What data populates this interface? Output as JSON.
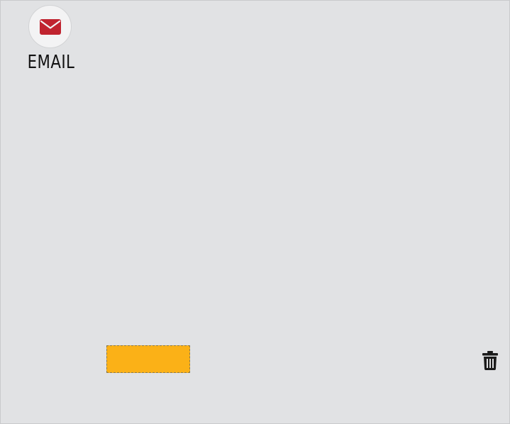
{
  "email_widget": {
    "label": "EMAIL",
    "icon": "envelope-icon",
    "icon_color": "#c0232f"
  },
  "placeholder_block": {
    "color": "#fbb117"
  },
  "trash": {
    "icon": "trash-icon",
    "color": "#1a1a1a"
  },
  "colors": {
    "canvas_background": "#e1e2e4",
    "button_background": "#f3f3f4"
  }
}
